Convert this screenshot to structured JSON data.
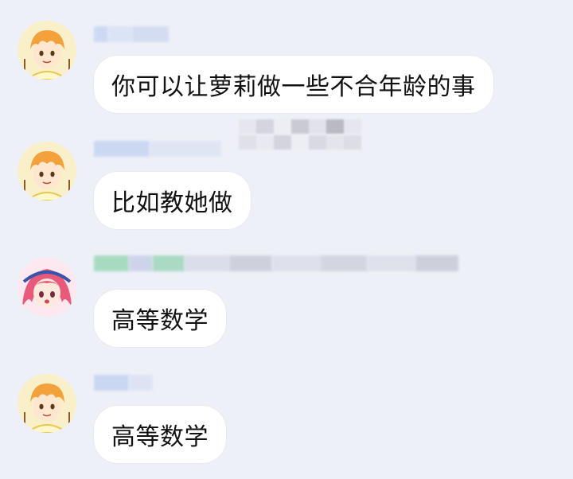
{
  "messages": [
    {
      "avatar": "orange-hair-boy-avatar",
      "text": "你可以让萝莉做一些不合年龄的事"
    },
    {
      "avatar": "orange-hair-boy-avatar",
      "text": "比如教她做"
    },
    {
      "avatar": "pink-hair-girl-avatar",
      "text": "高等数学"
    },
    {
      "avatar": "orange-hair-boy-avatar",
      "text": "高等数学"
    }
  ],
  "colors": {
    "background": "#eef0f7",
    "bubble": "#ffffff",
    "text": "#111111",
    "blur_blue": "#b9cdf1",
    "blur_green": "#8fd1ad"
  }
}
